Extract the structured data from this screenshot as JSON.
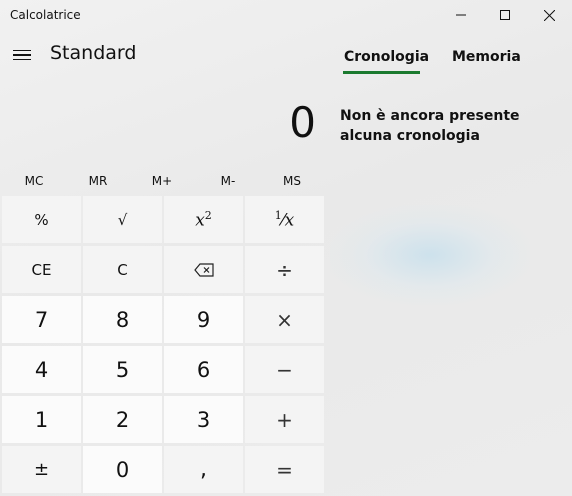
{
  "window": {
    "title": "Calcolatrice",
    "minimize_icon": "minimize-icon",
    "maximize_icon": "maximize-icon",
    "close_icon": "close-icon"
  },
  "header": {
    "menu_icon": "hamburger-icon",
    "mode": "Standard"
  },
  "tabs": [
    {
      "label": "Cronologia",
      "active": true
    },
    {
      "label": "Memoria",
      "active": false
    }
  ],
  "display": {
    "value": "0"
  },
  "history": {
    "empty_message": "Non è ancora presente alcuna cronologia"
  },
  "memory_buttons": [
    "MC",
    "MR",
    "M+",
    "M-",
    "MS"
  ],
  "keys": {
    "percent": "%",
    "sqrt": "√",
    "square_base": "x",
    "square_exp": "2",
    "reciprocal_num": "1",
    "reciprocal_den": "x",
    "ce": "CE",
    "c": "C",
    "backspace_icon": "backspace-icon",
    "divide": "÷",
    "seven": "7",
    "eight": "8",
    "nine": "9",
    "multiply": "×",
    "four": "4",
    "five": "5",
    "six": "6",
    "minus": "−",
    "one": "1",
    "two": "2",
    "three": "3",
    "plus": "+",
    "negate": "±",
    "zero": "0",
    "decimal": ",",
    "equals": "="
  },
  "colors": {
    "accent": "#1b7a2f",
    "number_key": "#fbfbfb",
    "function_key": "#f4f4f4"
  }
}
